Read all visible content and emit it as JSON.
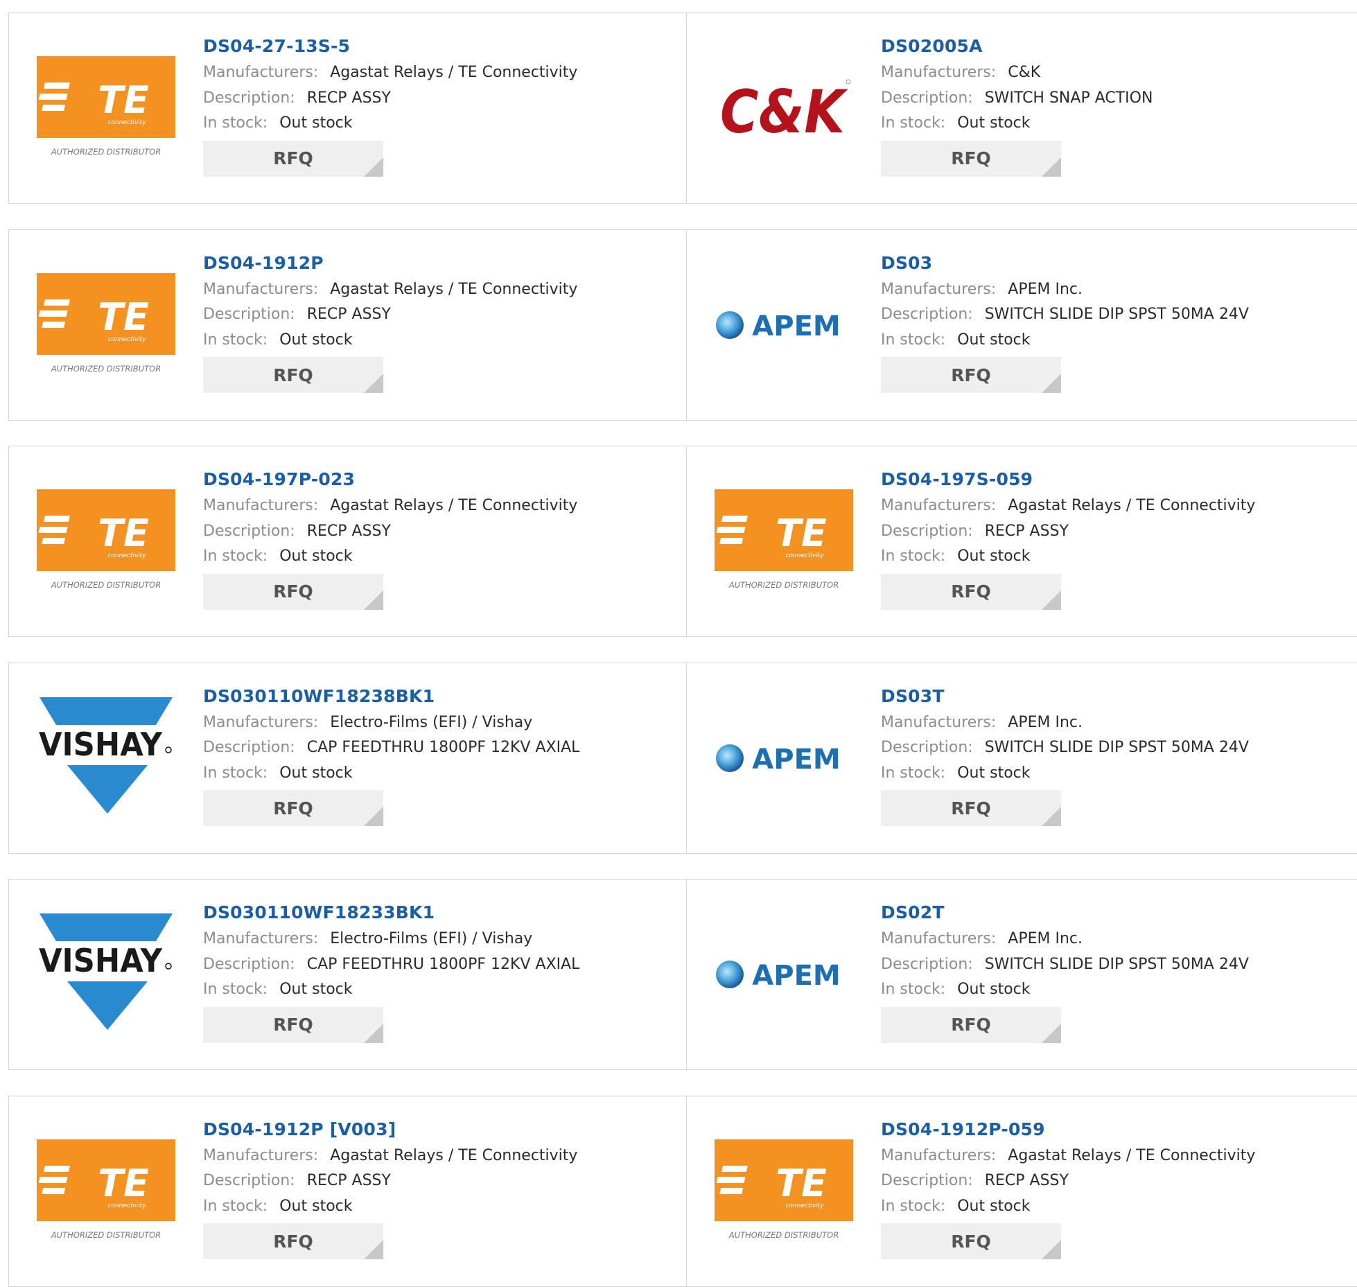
{
  "labels": {
    "manufacturers": "Manufacturers:",
    "description": "Description:",
    "in_stock": "In stock:",
    "rfq": "RFQ"
  },
  "logos": {
    "te": {
      "name": "TE",
      "sub": "connectivity",
      "tagline": "AUTHORIZED DISTRIBUTOR",
      "color": "#f39220"
    },
    "ck": {
      "name": "C&K",
      "color": "#b5121b"
    },
    "apem": {
      "name": "APEM",
      "color": "#1b6fb5"
    },
    "vishay": {
      "name": "VISHAY",
      "color": "#2a8ad0"
    }
  },
  "products": [
    {
      "part": "DS04-27-13S-5",
      "logo": "te",
      "manufacturer": "Agastat Relays / TE Connectivity",
      "description": "RECP ASSY",
      "stock": "Out stock"
    },
    {
      "part": "DS02005A",
      "logo": "ck",
      "manufacturer": "C&K",
      "description": "SWITCH SNAP ACTION",
      "stock": "Out stock"
    },
    {
      "part": "DS04-1912P",
      "logo": "te",
      "manufacturer": "Agastat Relays / TE Connectivity",
      "description": "RECP ASSY",
      "stock": "Out stock"
    },
    {
      "part": "DS03",
      "logo": "apem",
      "manufacturer": "APEM Inc.",
      "description": "SWITCH SLIDE DIP SPST 50MA 24V",
      "stock": "Out stock"
    },
    {
      "part": "DS04-197P-023",
      "logo": "te",
      "manufacturer": "Agastat Relays / TE Connectivity",
      "description": "RECP ASSY",
      "stock": "Out stock"
    },
    {
      "part": "DS04-197S-059",
      "logo": "te",
      "manufacturer": "Agastat Relays / TE Connectivity",
      "description": "RECP ASSY",
      "stock": "Out stock"
    },
    {
      "part": "DS030110WF18238BK1",
      "logo": "vishay",
      "manufacturer": "Electro-Films (EFI) / Vishay",
      "description": "CAP FEEDTHRU 1800PF 12KV AXIAL",
      "stock": "Out stock"
    },
    {
      "part": "DS03T",
      "logo": "apem",
      "manufacturer": "APEM Inc.",
      "description": "SWITCH SLIDE DIP SPST 50MA 24V",
      "stock": "Out stock"
    },
    {
      "part": "DS030110WF18233BK1",
      "logo": "vishay",
      "manufacturer": "Electro-Films (EFI) / Vishay",
      "description": "CAP FEEDTHRU 1800PF 12KV AXIAL",
      "stock": "Out stock"
    },
    {
      "part": "DS02T",
      "logo": "apem",
      "manufacturer": "APEM Inc.",
      "description": "SWITCH SLIDE DIP SPST 50MA 24V",
      "stock": "Out stock"
    },
    {
      "part": "DS04-1912P [V003]",
      "logo": "te",
      "manufacturer": "Agastat Relays / TE Connectivity",
      "description": "RECP ASSY",
      "stock": "Out stock"
    },
    {
      "part": "DS04-1912P-059",
      "logo": "te",
      "manufacturer": "Agastat Relays / TE Connectivity",
      "description": "RECP ASSY",
      "stock": "Out stock"
    }
  ]
}
